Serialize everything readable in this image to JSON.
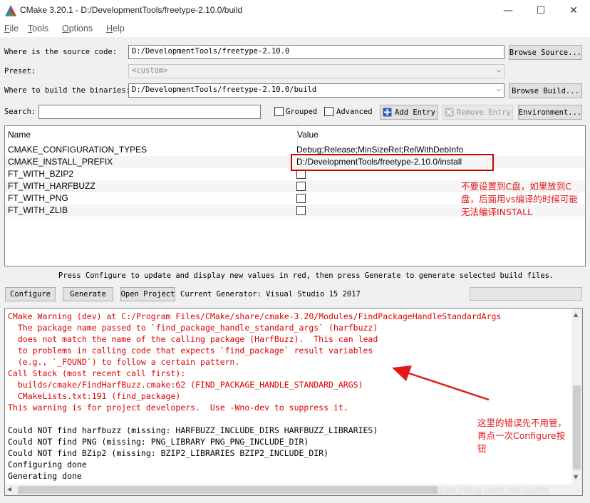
{
  "window": {
    "title": "CMake 3.20.1 - D:/DevelopmentTools/freetype-2.10.0/build",
    "minimize": "—",
    "maximize": "☐",
    "close": "✕"
  },
  "menu": [
    {
      "label": "File"
    },
    {
      "label": "Tools"
    },
    {
      "label": "Options"
    },
    {
      "label": "Help"
    }
  ],
  "source": {
    "label": "Where is the source code:",
    "value": "D:/DevelopmentTools/freetype-2.10.0",
    "browse": "Browse Source..."
  },
  "preset": {
    "label": "Preset:",
    "value": "<custom>"
  },
  "build": {
    "label": "Where to build the binaries:",
    "value": "D:/DevelopmentTools/freetype-2.10.0/build",
    "browse": "Browse Build..."
  },
  "search": {
    "label": "Search:",
    "value": "",
    "grouped": "Grouped",
    "advanced": "Advanced",
    "add_entry": "Add Entry",
    "remove_entry": "Remove Entry",
    "environment": "Environment..."
  },
  "table": {
    "headers": {
      "name": "Name",
      "value": "Value"
    },
    "rows": [
      {
        "name": "CMAKE_CONFIGURATION_TYPES",
        "value": "Debug;Release;MinSizeRel;RelWithDebInfo"
      },
      {
        "name": "CMAKE_INSTALL_PREFIX",
        "value": "D:/DevelopmentTools/freetype-2.10.0/install"
      },
      {
        "name": "FT_WITH_BZIP2",
        "checked": false
      },
      {
        "name": "FT_WITH_HARFBUZZ",
        "checked": false
      },
      {
        "name": "FT_WITH_PNG",
        "checked": false
      },
      {
        "name": "FT_WITH_ZLIB",
        "checked": false
      }
    ]
  },
  "annotation_install": {
    "line1": "不要设置到C盘，如果放到C",
    "line2": "盘，后面用vs编译的时候可能",
    "line3": "无法编译INSTALL"
  },
  "hint": "Press Configure to update and display new values in red, then press Generate to generate selected build files.",
  "actions": {
    "configure": "Configure",
    "generate": "Generate",
    "open_project": "Open Project",
    "generator": "Current Generator: Visual Studio 15 2017"
  },
  "output": {
    "lines": [
      {
        "text": "CMake Warning (dev) at C:/Program Files/CMake/share/cmake-3.20/Modules/FindPackageHandleStandardArgs",
        "red": true
      },
      {
        "text": "  The package name passed to `find_package_handle_standard_args` (harfbuzz)",
        "red": true
      },
      {
        "text": "  does not match the name of the calling package (HarfBuzz).  This can lead",
        "red": true
      },
      {
        "text": "  to problems in calling code that expects `find_package` result variables",
        "red": true
      },
      {
        "text": "  (e.g., `_FOUND`) to follow a certain pattern.",
        "red": true
      },
      {
        "text": "Call Stack (most recent call first):",
        "red": true
      },
      {
        "text": "  builds/cmake/FindHarfBuzz.cmake:62 (FIND_PACKAGE_HANDLE_STANDARD_ARGS)",
        "red": true
      },
      {
        "text": "  CMakeLists.txt:191 (find_package)",
        "red": true
      },
      {
        "text": "This warning is for project developers.  Use -Wno-dev to suppress it.",
        "red": true
      },
      {
        "text": "",
        "red": false
      },
      {
        "text": "Could NOT find harfbuzz (missing: HARFBUZZ_INCLUDE_DIRS HARFBUZZ_LIBRARIES)",
        "red": false
      },
      {
        "text": "Could NOT find PNG (missing: PNG_LIBRARY PNG_PNG_INCLUDE_DIR)",
        "red": false
      },
      {
        "text": "Could NOT find BZip2 (missing: BZIP2_LIBRARIES BZIP2_INCLUDE_DIR)",
        "red": false
      },
      {
        "text": "Configuring done",
        "red": false
      },
      {
        "text": "Generating done",
        "red": false
      }
    ]
  },
  "annotation_error": {
    "line1": "这里的错误先不用管，",
    "line2": "再点一次Configure按",
    "line3": "钮"
  },
  "watermark": "https://blog.csdn.net/JayXie",
  "colors": {
    "annotation_red": "#e31919",
    "warning_red": "#e00000"
  }
}
